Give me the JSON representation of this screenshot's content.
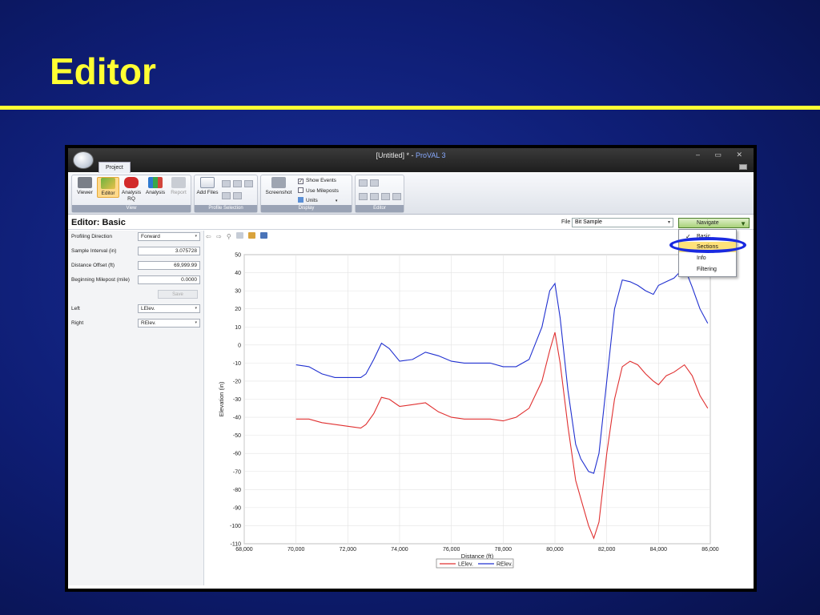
{
  "slide": {
    "title": "Editor"
  },
  "window": {
    "title_prefix": "[Untitled] * - ",
    "app_name": "ProVAL 3",
    "controls": "– ▭ ✕",
    "tab_project": "Project"
  },
  "ribbon": {
    "view_group": {
      "label": "View",
      "buttons": [
        "Viewer",
        "Editor",
        "Analysis RQ",
        "Analysis",
        "Report"
      ]
    },
    "profile_group": {
      "label": "Profile Selection",
      "add_files": "Add Files"
    },
    "display_group": {
      "label": "Display",
      "screenshot": "Screenshot",
      "show_events": "Show Events",
      "use_mileposts": "Use Mileposts",
      "units": "Units"
    },
    "editor_group": {
      "label": "Editor"
    }
  },
  "editor_bar": {
    "title": "Editor: Basic",
    "file_label": "File",
    "file_value": "Bit Sample",
    "navigate_label": "Navigate"
  },
  "navigate_menu": {
    "items": [
      "Basic",
      "Sections",
      "Info",
      "Filtering"
    ],
    "checked": "Basic",
    "highlighted": "Sections"
  },
  "left_panel": {
    "profiling_direction": {
      "label": "Profiling Direction",
      "value": "Forward"
    },
    "sample_interval": {
      "label": "Sample Interval (in)",
      "value": "3.075728"
    },
    "distance_offset": {
      "label": "Distance Offset (ft)",
      "value": "69,999.99"
    },
    "beginning_milepost": {
      "label": "Beginning Milepost (mile)",
      "value": "0.0000"
    },
    "save": "Save",
    "left": {
      "label": "Left",
      "value": "LElev."
    },
    "right": {
      "label": "Right",
      "value": "RElev."
    }
  },
  "colors": {
    "left_series": "#e03030",
    "right_series": "#2030d0",
    "highlight": "#ffe27a",
    "oval": "#1a2ae0",
    "slide_title": "#ffff33"
  },
  "chart_data": {
    "type": "line",
    "xlabel": "Distance (ft)",
    "ylabel": "Elevation (in)",
    "xlim": [
      68000,
      86000
    ],
    "ylim": [
      -110,
      50
    ],
    "xticks": [
      "68,000",
      "70,000",
      "72,000",
      "74,000",
      "76,000",
      "78,000",
      "80,000",
      "82,000",
      "84,000",
      "86,000"
    ],
    "yticks": [
      50,
      40,
      30,
      20,
      10,
      0,
      -10,
      -20,
      -30,
      -40,
      -50,
      -60,
      -70,
      -80,
      -90,
      -100,
      -110
    ],
    "grid": true,
    "legend": "bottom-center",
    "series": [
      {
        "name": "LElev.",
        "x": [
          70000,
          70500,
          71000,
          71500,
          72000,
          72500,
          72700,
          73000,
          73300,
          73600,
          74000,
          74500,
          75000,
          75500,
          76000,
          76500,
          77000,
          77500,
          78000,
          78500,
          79000,
          79500,
          79800,
          80000,
          80200,
          80500,
          80800,
          81000,
          81300,
          81500,
          81700,
          82000,
          82300,
          82600,
          82900,
          83200,
          83500,
          83800,
          84000,
          84300,
          84600,
          85000,
          85300,
          85600,
          85900
        ],
        "y": [
          -41,
          -41,
          -43,
          -44,
          -45,
          -46,
          -44,
          -38,
          -29,
          -30,
          -34,
          -33,
          -32,
          -37,
          -40,
          -41,
          -41,
          -41,
          -42,
          -40,
          -35,
          -20,
          -3,
          7,
          -10,
          -45,
          -75,
          -85,
          -100,
          -107,
          -98,
          -60,
          -30,
          -12,
          -9,
          -11,
          -16,
          -20,
          -22,
          -17,
          -15,
          -11,
          -17,
          -28,
          -35
        ]
      },
      {
        "name": "RElev.",
        "x": [
          70000,
          70500,
          71000,
          71500,
          72000,
          72500,
          72700,
          73000,
          73300,
          73600,
          74000,
          74500,
          75000,
          75500,
          76000,
          76500,
          77000,
          77500,
          78000,
          78500,
          79000,
          79500,
          79800,
          80000,
          80200,
          80500,
          80800,
          81000,
          81300,
          81500,
          81700,
          82000,
          82300,
          82600,
          82900,
          83200,
          83500,
          83800,
          84000,
          84300,
          84600,
          85000,
          85300,
          85600,
          85900
        ],
        "y": [
          -11,
          -12,
          -16,
          -18,
          -18,
          -18,
          -16,
          -8,
          1,
          -2,
          -9,
          -8,
          -4,
          -6,
          -9,
          -10,
          -10,
          -10,
          -12,
          -12,
          -8,
          10,
          30,
          34,
          15,
          -25,
          -55,
          -63,
          -70,
          -71,
          -60,
          -20,
          20,
          36,
          35,
          33,
          30,
          28,
          33,
          35,
          37,
          43,
          32,
          20,
          12
        ]
      }
    ]
  }
}
